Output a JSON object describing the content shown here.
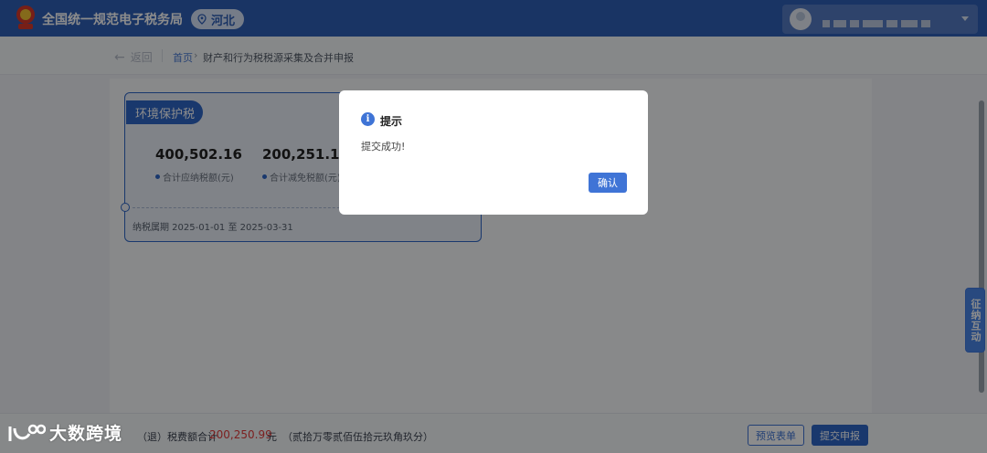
{
  "header": {
    "site_title": "全国统一规范电子税务局",
    "region": "河北",
    "colors": {
      "bar": "#2f5fb6"
    }
  },
  "breadcrumb": {
    "back": "返回",
    "home": "首页",
    "separator": "›",
    "current": "财产和行为税税源采集及合并申报"
  },
  "tax_card": {
    "tag": "环境保护税",
    "stats": [
      {
        "value": "400,502.16",
        "label": "合计应纳税额(元)"
      },
      {
        "value": "200,251.17",
        "label": "合计减免税额(元)"
      }
    ],
    "period": "纳税属期 2025-01-01 至 2025-03-31"
  },
  "side_float": {
    "label": "征纳互动"
  },
  "bottom_bar": {
    "label": "（退）税费额合计",
    "amount": "200,250.99",
    "unit": "元",
    "amount_words": "（贰拾万零贰佰伍拾元玖角玖分）",
    "preview_button": "预览表单",
    "submit_button": "提交申报"
  },
  "watermark": {
    "text": "大数跨境"
  },
  "dialog": {
    "icon": "info-icon",
    "title": "提示",
    "message": "提交成功!",
    "confirm_button": "确认"
  }
}
